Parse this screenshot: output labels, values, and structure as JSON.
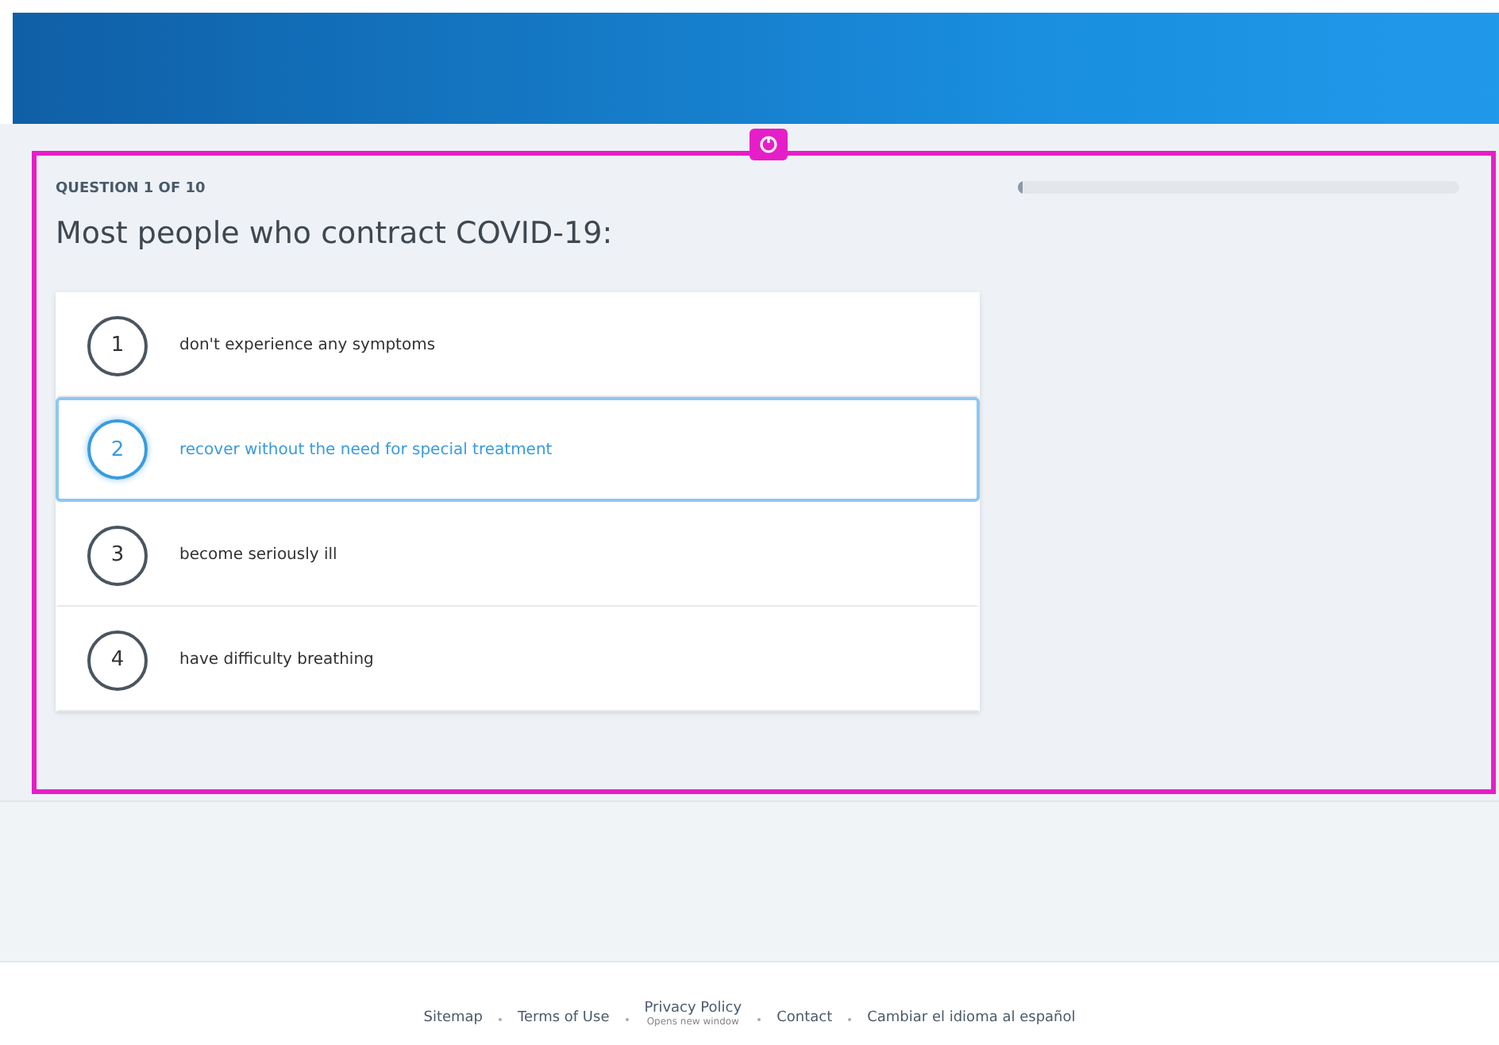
{
  "quiz": {
    "counter": "QUESTION 1 OF 10",
    "question": "Most people who contract COVID-19:",
    "progress": {
      "level": 0.01
    },
    "answers": [
      {
        "number": "1",
        "text": "don't experience any symptoms",
        "selected": false
      },
      {
        "number": "2",
        "text": "recover without the need for special treatment",
        "selected": true
      },
      {
        "number": "3",
        "text": "become seriously ill",
        "selected": false
      },
      {
        "number": "4",
        "text": "have difficulty breathing",
        "selected": false
      }
    ]
  },
  "footer": {
    "links": [
      {
        "label": "Sitemap"
      },
      {
        "label": "Terms of Use"
      },
      {
        "label": "Privacy Policy",
        "note": "Opens new window"
      },
      {
        "label": "Contact"
      },
      {
        "label": "Cambiar el idioma al español"
      }
    ]
  }
}
